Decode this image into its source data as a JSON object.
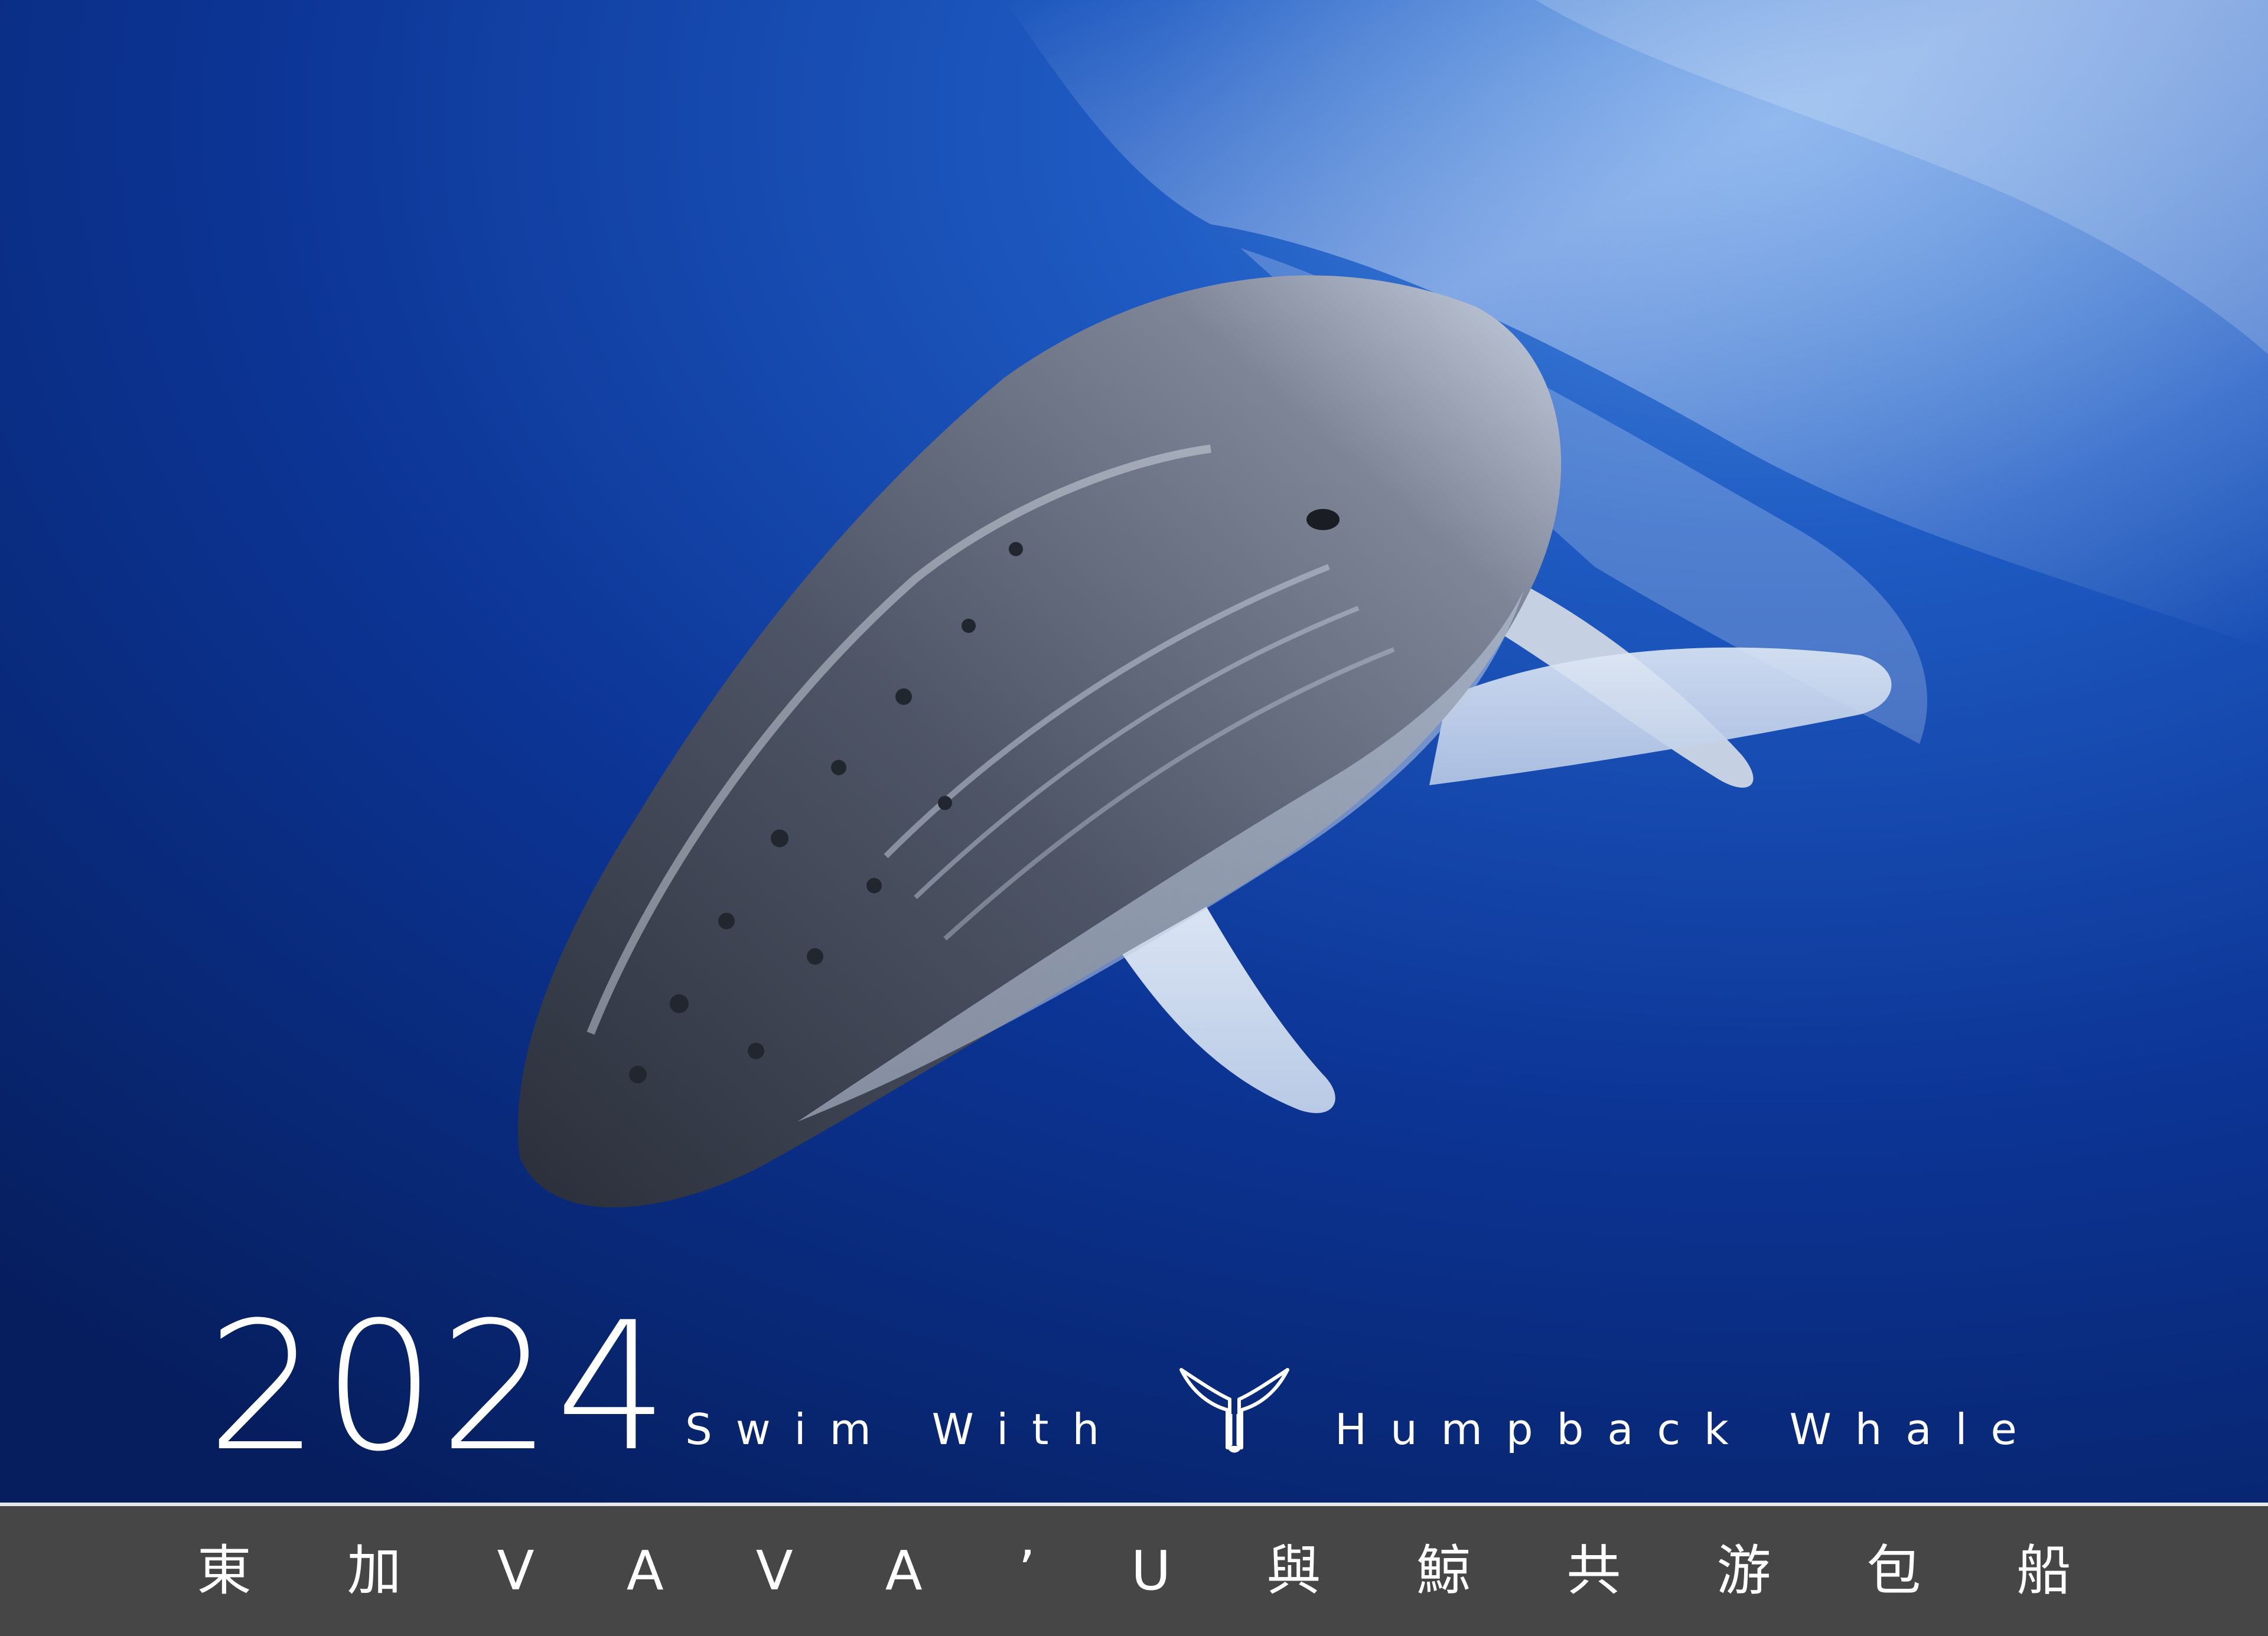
{
  "calendar": {
    "year": "2024",
    "tagline_part1": "Swim With",
    "tagline_part2": "Humpback Whale",
    "subtitle": "東加VAVA’U與鯨共游包船",
    "logo_icon": "whale-tail-icon"
  },
  "colors": {
    "ocean_dark": "#07236a",
    "ocean_mid": "#0d3aa0",
    "ocean_light": "#3f7fd6",
    "bar": "#464646",
    "text": "#ffffff"
  }
}
